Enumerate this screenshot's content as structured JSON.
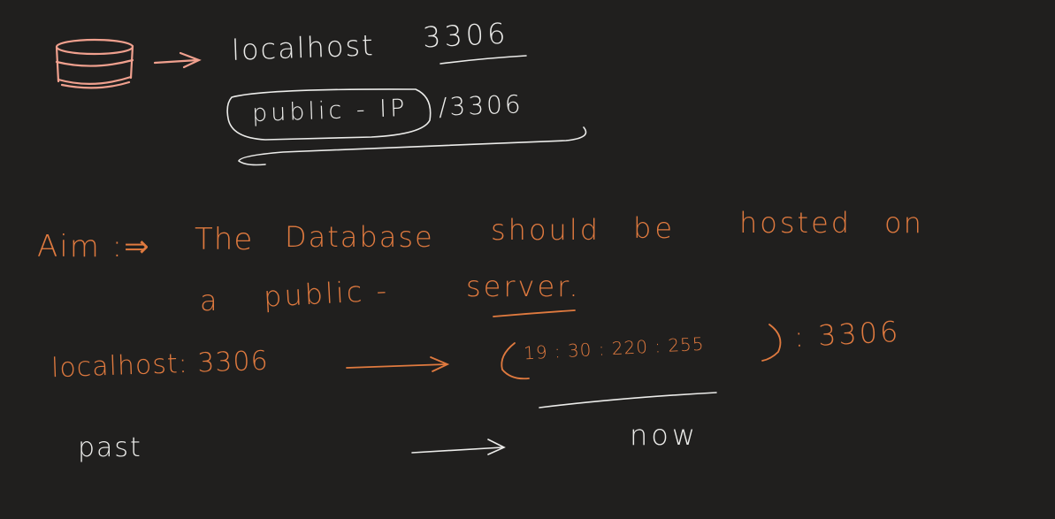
{
  "canvas": {
    "background": "#201f1e",
    "ink_white": "#ececea",
    "ink_orange": "#e07a3f",
    "ink_pink": "#f0a08e"
  },
  "notes": {
    "top": {
      "database_icon": "database-icon",
      "host": "localhost",
      "port": "3306",
      "public_ip": "public - IP",
      "public_port": "/3306"
    },
    "aim": {
      "label": "Aim :⇒",
      "line1": [
        "The",
        "Database",
        "should",
        "be",
        "hosted",
        "on"
      ],
      "line2": [
        "a",
        "public -",
        "server."
      ]
    },
    "mapping": {
      "from": "localhost: 3306",
      "ip": "19 : 30 : 220 : 255",
      "to_port": ": 3306"
    },
    "timeline": {
      "past": "past",
      "now": "now"
    }
  }
}
